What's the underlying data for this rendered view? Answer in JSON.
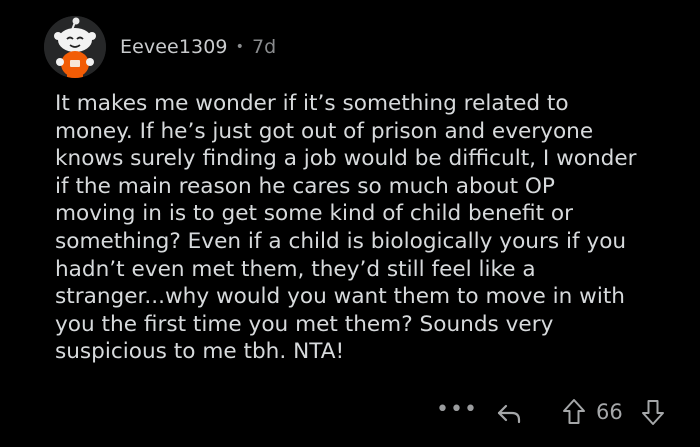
{
  "comment": {
    "author": "Eevee1309",
    "separator": "•",
    "age": "7d",
    "text": "It makes me wonder if it’s something related to\nmoney. If he’s just got out of prison and everyone\nknows surely finding a job would be difficult, I wonder\nif the main reason he cares so much about OP\nmoving in is to get some kind of child benefit or\nsomething? Even if a child is biologically yours if you\nhadn’t even met them, they’d still feel like a\nstranger...why would you want them to move in with\nyou the first time you met them? Sounds very\nsuspicious to me tbh. NTA!",
    "score": "66"
  },
  "actions": {
    "more_label": "•••",
    "reply_icon": "reply-icon",
    "upvote_icon": "upvote-arrow-icon",
    "downvote_icon": "downvote-arrow-icon"
  },
  "colors": {
    "background": "#000000",
    "text": "#d7dadc",
    "muted": "#8a8c8e",
    "avatar_accent": "#f25c05"
  }
}
